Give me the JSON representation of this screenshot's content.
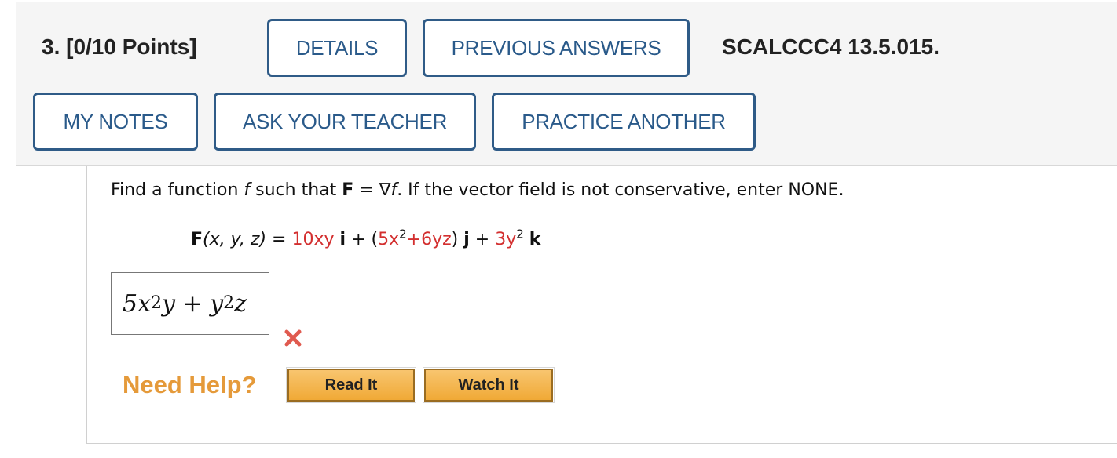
{
  "header": {
    "question_number": "3. [0/10 Points]",
    "details_label": "DETAILS",
    "previous_answers_label": "PREVIOUS ANSWERS",
    "question_code": "SCALCCC4 13.5.015.",
    "my_notes_label": "MY NOTES",
    "ask_teacher_label": "ASK YOUR TEACHER",
    "practice_another_label": "PRACTICE ANOTHER"
  },
  "problem": {
    "prompt_part1": "Find a function ",
    "prompt_f": "f",
    "prompt_part2": " such that ",
    "prompt_F": "F",
    "prompt_part3": " = ∇",
    "prompt_f2": "f",
    "prompt_part4": ". If the vector field is not conservative, enter NONE.",
    "field_F": "F",
    "field_args": "(x, y, z)",
    "field_eq": " = ",
    "term1": "10xy",
    "unit_i": "i",
    "plus1": " + (",
    "term2_a": "5x",
    "term2_exp": "2",
    "term2_b": "+6yz",
    "close_paren": ") ",
    "unit_j": "j",
    "plus2": " + ",
    "term3_a": "3y",
    "term3_exp": "2",
    "unit_k": "k"
  },
  "answer": {
    "part1": "5x",
    "exp1": "2",
    "part2": "y + y",
    "exp2": "2",
    "part3": "z",
    "status": "incorrect"
  },
  "help": {
    "need_help_label": "Need Help?",
    "read_it_label": "Read It",
    "watch_it_label": "Watch It"
  },
  "colors": {
    "button_border": "#2f5b87",
    "button_text": "#2a5a8a",
    "accent_red": "#d32f2f",
    "help_orange": "#e59a3a"
  }
}
